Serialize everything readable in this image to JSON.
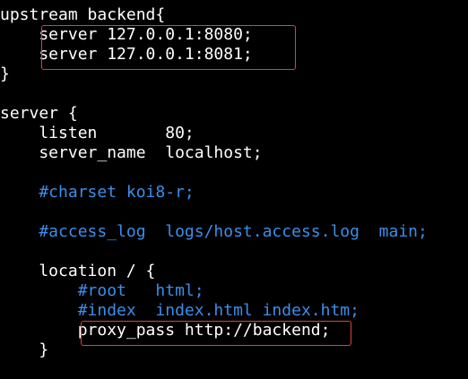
{
  "config": {
    "lines": [
      {
        "text": "upstream backend{",
        "style": "normal"
      },
      {
        "text": "    server 127.0.0.1:8080;",
        "style": "normal"
      },
      {
        "text": "    server 127.0.0.1:8081;",
        "style": "normal"
      },
      {
        "text": "}",
        "style": "normal"
      },
      {
        "text": "",
        "style": "normal"
      },
      {
        "text": "server {",
        "style": "normal"
      },
      {
        "text": "    listen       80;",
        "style": "normal"
      },
      {
        "text": "    server_name  localhost;",
        "style": "normal"
      },
      {
        "text": "",
        "style": "normal"
      },
      {
        "text": "    #charset koi8-r;",
        "style": "comment"
      },
      {
        "text": "",
        "style": "normal"
      },
      {
        "text": "    #access_log  logs/host.access.log  main;",
        "style": "comment"
      },
      {
        "text": "",
        "style": "normal"
      },
      {
        "text": "    location / {",
        "style": "normal"
      },
      {
        "text": "        #root   html;",
        "style": "comment"
      },
      {
        "text": "        #index  index.html index.htm;",
        "style": "comment"
      },
      {
        "text": "        proxy_pass http://backend;",
        "style": "normal"
      },
      {
        "text": "    }",
        "style": "normal"
      }
    ]
  },
  "colors": {
    "background": "#000000",
    "text": "#ffffff",
    "comment": "#3b8eea",
    "highlight_border": "#e0403a"
  }
}
